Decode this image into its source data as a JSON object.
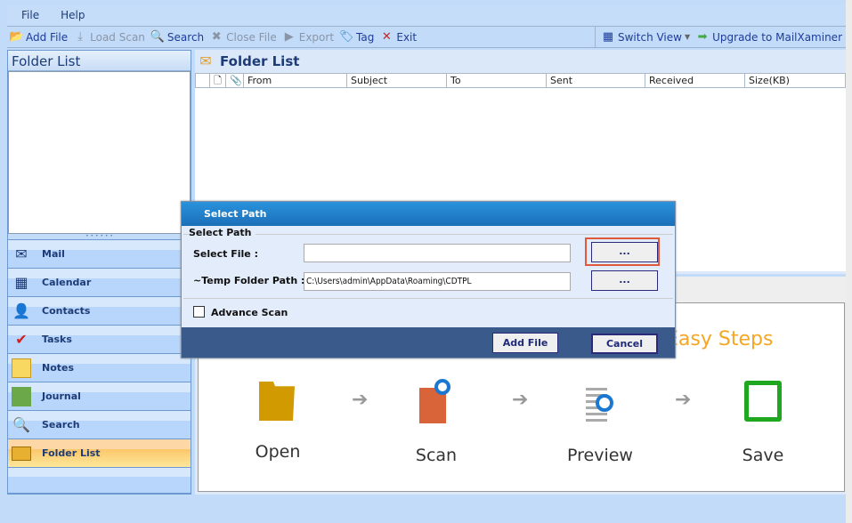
{
  "menu": {
    "file": "File",
    "help": "Help"
  },
  "toolbar": {
    "add_file": "Add File",
    "load_scan": "Load Scan",
    "search": "Search",
    "close_file": "Close File",
    "export": "Export",
    "tag": "Tag",
    "exit": "Exit",
    "switch_view": "Switch View",
    "upgrade": "Upgrade to MailXaminer"
  },
  "left": {
    "title": "Folder List",
    "nav": [
      {
        "label": "Mail",
        "icon": "mail-icon"
      },
      {
        "label": "Calendar",
        "icon": "calendar-icon"
      },
      {
        "label": "Contacts",
        "icon": "contacts-icon"
      },
      {
        "label": "Tasks",
        "icon": "tasks-icon"
      },
      {
        "label": "Notes",
        "icon": "notes-icon"
      },
      {
        "label": "Journal",
        "icon": "journal-icon"
      },
      {
        "label": "Search",
        "icon": "search-icon"
      },
      {
        "label": "Folder List",
        "icon": "folder-icon",
        "selected": true
      }
    ]
  },
  "right": {
    "title": "Folder List",
    "columns": [
      "From",
      "Subject",
      "To",
      "Sent",
      "Received",
      "Size(KB)"
    ]
  },
  "steps": {
    "heading": "Easy Steps",
    "items": [
      "Open",
      "Scan",
      "Preview",
      "Save"
    ]
  },
  "dialog": {
    "title": "Select Path",
    "group": "Select Path",
    "select_file_label": "Select File :",
    "select_file_value": "",
    "temp_label": "~Temp Folder Path :",
    "temp_value": "C:\\Users\\admin\\AppData\\Roaming\\CDTPL",
    "browse": "...",
    "advance_scan": "Advance Scan",
    "advance_scan_checked": false,
    "add_file": "Add File",
    "cancel": "Cancel"
  },
  "colors": {
    "accent": "#1a6fb8",
    "highlight": "#e05a3a",
    "steps_heading": "#f5a623"
  }
}
